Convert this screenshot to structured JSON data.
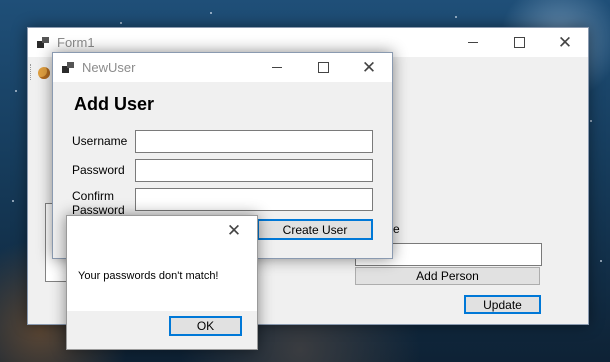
{
  "form1": {
    "title": "Form1"
  },
  "newuser": {
    "title": "NewUser",
    "heading": "Add User",
    "username_label": "Username",
    "password_label": "Password",
    "confirm_label_line1": "Confirm",
    "confirm_label_line2": "Password",
    "username_value": "",
    "password_value": "",
    "confirm_value": "",
    "create_button": "Create User"
  },
  "form1_controls": {
    "name_label_partial": "me",
    "name_value": "",
    "add_person_button": "Add Person",
    "update_button": "Update"
  },
  "msgbox": {
    "message": "Your passwords don't match!",
    "ok_button": "OK"
  },
  "icons": [
    "app-icon",
    "minimize-icon",
    "maximize-icon",
    "close-icon",
    "toolbar-icon"
  ]
}
